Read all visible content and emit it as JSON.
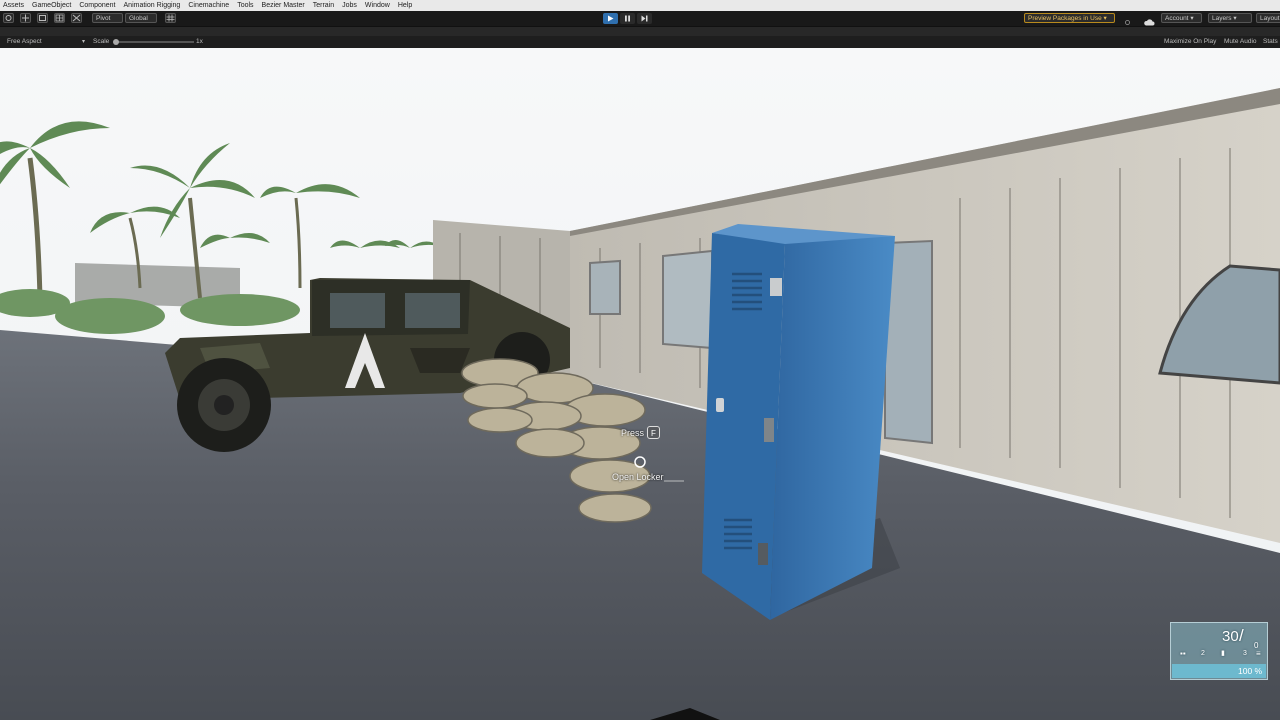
{
  "menu": [
    "Assets",
    "GameObject",
    "Component",
    "Animation Rigging",
    "Cinemachine",
    "Tools",
    "Bezier Master",
    "Terrain",
    "Jobs",
    "Window",
    "Help"
  ],
  "toolbar": {
    "pivot_label": "Pivot",
    "global_label": "Global",
    "preview_packages_label": "Preview Packages in Use",
    "account_label": "Account",
    "layers_label": "Layers",
    "layout_label": "Layout"
  },
  "gameview": {
    "aspect_label": "Free Aspect",
    "scale_label": "Scale",
    "scale_value": "1x",
    "maximize_label": "Maximize On Play",
    "mute_label": "Mute Audio",
    "stats_label": "Stats"
  },
  "prompt": {
    "press_label": "Press",
    "key_label": "F",
    "action_label": "Open Locker"
  },
  "hud": {
    "ammo_in_mag": "30",
    "ammo_reserve": "0",
    "slot_a": "2",
    "slot_b": "3",
    "health_label": "100 %"
  },
  "colors": {
    "sky": "#f4f6f7",
    "ground": "#53575f",
    "locker": "#3f7dba",
    "wall": "#c9c6bd",
    "accent": "#2f6fae"
  }
}
